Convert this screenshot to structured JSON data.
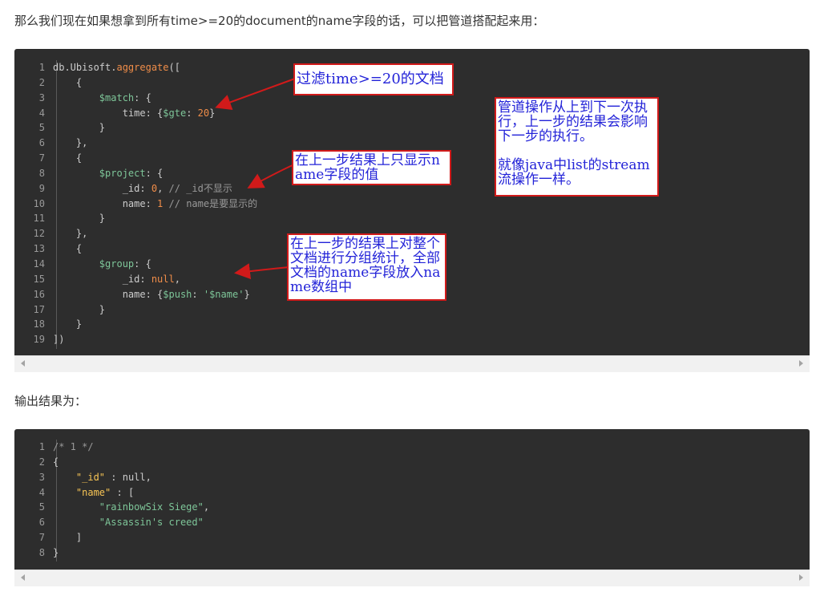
{
  "intro_text": "那么我们现在如果想拿到所有time>=20的document的name字段的话，可以把管道搭配起来用：",
  "output_text": "输出结果为：",
  "code1": {
    "line_numbers": [
      "1",
      "2",
      "3",
      "4",
      "5",
      "6",
      "7",
      "8",
      "9",
      "10",
      "11",
      "12",
      "13",
      "14",
      "15",
      "16",
      "17",
      "18",
      "19"
    ],
    "lines": [
      [
        {
          "t": "db.Ubisoft.",
          "c": "plain"
        },
        {
          "t": "aggregate",
          "c": "fn"
        },
        {
          "t": "([",
          "c": "plain"
        }
      ],
      [
        {
          "t": "    {",
          "c": "plain"
        }
      ],
      [
        {
          "t": "        $match",
          "c": "key"
        },
        {
          "t": ": {",
          "c": "plain"
        }
      ],
      [
        {
          "t": "            time: {",
          "c": "plain"
        },
        {
          "t": "$gte",
          "c": "key"
        },
        {
          "t": ": ",
          "c": "plain"
        },
        {
          "t": "20",
          "c": "num"
        },
        {
          "t": "}",
          "c": "plain"
        }
      ],
      [
        {
          "t": "        }",
          "c": "plain"
        }
      ],
      [
        {
          "t": "    },",
          "c": "plain"
        }
      ],
      [
        {
          "t": "    {",
          "c": "plain"
        }
      ],
      [
        {
          "t": "        $project",
          "c": "key"
        },
        {
          "t": ": {",
          "c": "plain"
        }
      ],
      [
        {
          "t": "            _id: ",
          "c": "plain"
        },
        {
          "t": "0",
          "c": "num"
        },
        {
          "t": ", ",
          "c": "plain"
        },
        {
          "t": "// _id不显示",
          "c": "comment"
        }
      ],
      [
        {
          "t": "            name: ",
          "c": "plain"
        },
        {
          "t": "1",
          "c": "num"
        },
        {
          "t": " ",
          "c": "plain"
        },
        {
          "t": "// name是要显示的",
          "c": "comment"
        }
      ],
      [
        {
          "t": "        }",
          "c": "plain"
        }
      ],
      [
        {
          "t": "    },",
          "c": "plain"
        }
      ],
      [
        {
          "t": "    {",
          "c": "plain"
        }
      ],
      [
        {
          "t": "        $group",
          "c": "key"
        },
        {
          "t": ": {",
          "c": "plain"
        }
      ],
      [
        {
          "t": "            _id: ",
          "c": "plain"
        },
        {
          "t": "null",
          "c": "num"
        },
        {
          "t": ",",
          "c": "plain"
        }
      ],
      [
        {
          "t": "            name: {",
          "c": "plain"
        },
        {
          "t": "$push",
          "c": "key"
        },
        {
          "t": ": ",
          "c": "plain"
        },
        {
          "t": "'$name'",
          "c": "str"
        },
        {
          "t": "}",
          "c": "plain"
        }
      ],
      [
        {
          "t": "        }",
          "c": "plain"
        }
      ],
      [
        {
          "t": "    }",
          "c": "plain"
        }
      ],
      [
        {
          "t": "])",
          "c": "plain"
        }
      ]
    ]
  },
  "code2": {
    "line_numbers": [
      "1",
      "2",
      "3",
      "4",
      "5",
      "6",
      "7",
      "8"
    ],
    "lines": [
      [
        {
          "t": "/* 1 */",
          "c": "comment"
        }
      ],
      [
        {
          "t": "{",
          "c": "plain"
        }
      ],
      [
        {
          "t": "    ",
          "c": "plain"
        },
        {
          "t": "\"_id\"",
          "c": "prop"
        },
        {
          "t": " : ",
          "c": "plain"
        },
        {
          "t": "null",
          "c": "plain"
        },
        {
          "t": ",",
          "c": "plain"
        }
      ],
      [
        {
          "t": "    ",
          "c": "plain"
        },
        {
          "t": "\"name\"",
          "c": "prop"
        },
        {
          "t": " : [",
          "c": "plain"
        }
      ],
      [
        {
          "t": "        ",
          "c": "plain"
        },
        {
          "t": "\"rainbowSix Siege\"",
          "c": "str"
        },
        {
          "t": ",",
          "c": "plain"
        }
      ],
      [
        {
          "t": "        ",
          "c": "plain"
        },
        {
          "t": "\"Assassin's creed\"",
          "c": "str"
        }
      ],
      [
        {
          "t": "    ]",
          "c": "plain"
        }
      ],
      [
        {
          "t": "}",
          "c": "plain"
        }
      ]
    ]
  },
  "colors": {
    "plain": "#cccccc",
    "fn": "#f08d49",
    "key": "#7ec699",
    "num": "#f08d49",
    "str": "#7ec699",
    "comment": "#999999",
    "prop": "#f8c555",
    "arrow": "#d11a1a"
  },
  "notes": {
    "filter": "过滤time>=20的文档",
    "project": "在上一步结果上只显示name字段的值",
    "group": "在上一步的结果上对整个文档进行分组统计，全部文档的name字段放入name数组中",
    "pipeline": "管道操作从上到下一次执行，上一步的结果会影响下一步的执行。\n\n就像java中list的stream流操作一样。"
  },
  "icons": {
    "scroll_left": "triangle-left-icon",
    "scroll_right": "triangle-right-icon"
  }
}
